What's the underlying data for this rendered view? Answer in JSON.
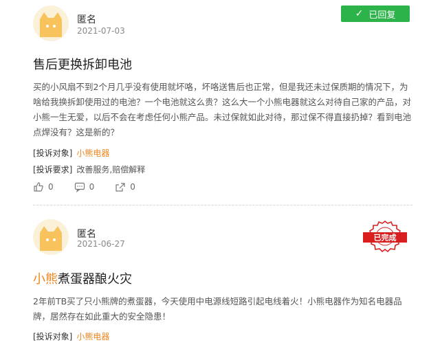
{
  "posts": [
    {
      "user": "匿名",
      "date": "2021-07-03",
      "badge": "已回复",
      "title": "售后更换拆卸电池",
      "content": "买的小风扇不到2个月几乎没有使用就坏咯，坏咯送售后也正常，但是我还未过保质期的情况下，为啥给我换拆卸使用过的电池？一个电池就这么贵？这么大一个小熊电器就这么对待自己家的产品，对小熊一生无爱，以后不会在考虑任何小熊产品。未过保就如此对待，那过保不得直接扔掉？看到电池点焊没有？这是新的？",
      "target_label": "[投诉对象]",
      "target_value": "小熊电器",
      "request_label": "[投诉要求]",
      "request_value": "改善服务,赔偿解释",
      "likes": "0",
      "comments": "0",
      "shares": "0"
    },
    {
      "user": "匿名",
      "date": "2021-06-27",
      "stamp": "已完成",
      "title_highlight": "小熊",
      "title_rest": "煮蛋器酿火灾",
      "content": "2年前TB买了只小熊牌的煮蛋器，今天使用中电源线短路引起电线着火！小熊电器作为知名电器品牌，居然存在如此重大的安全隐患！",
      "target_label": "[投诉对象]",
      "target_value": "小熊电器"
    }
  ],
  "colors": {
    "accent": "#f0861f",
    "replied": "#2cb34a",
    "stamp": "#d81e1e"
  }
}
